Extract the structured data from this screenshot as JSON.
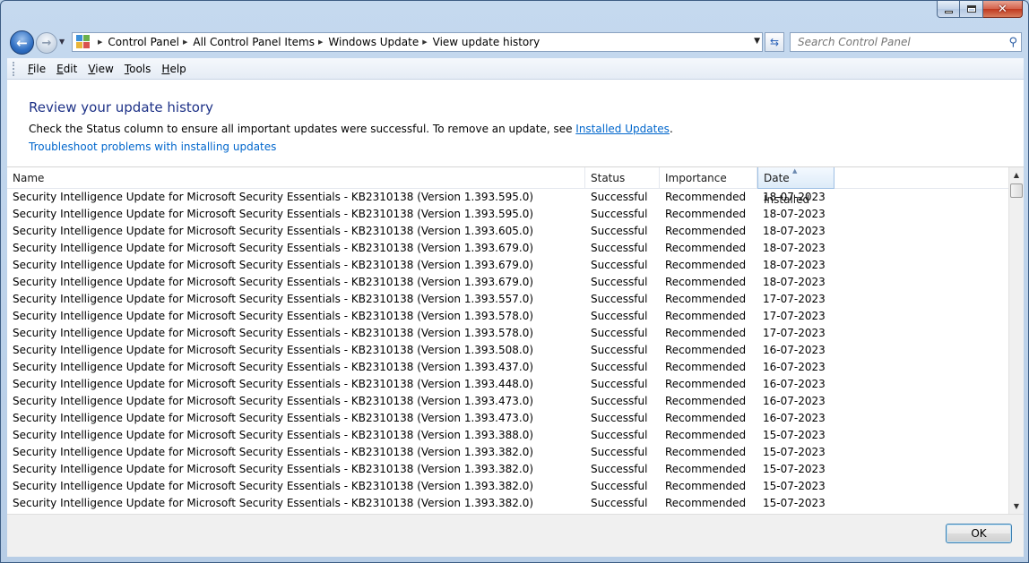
{
  "window": {
    "controls": {
      "minimize": "minimize",
      "maximize": "maximize",
      "close": "close"
    }
  },
  "navigation": {
    "breadcrumbs": [
      "Control Panel",
      "All Control Panel Items",
      "Windows Update",
      "View update history"
    ],
    "search_placeholder": "Search Control Panel"
  },
  "menu": {
    "items": [
      {
        "label": "File",
        "accel": "F",
        "rest": "ile"
      },
      {
        "label": "Edit",
        "accel": "E",
        "rest": "dit"
      },
      {
        "label": "View",
        "accel": "V",
        "rest": "iew"
      },
      {
        "label": "Tools",
        "accel": "T",
        "rest": "ools"
      },
      {
        "label": "Help",
        "accel": "H",
        "rest": "elp"
      }
    ]
  },
  "content": {
    "heading": "Review your update history",
    "description_prefix": "Check the Status column to ensure all important updates were successful. To remove an update, see ",
    "installed_updates_link": "Installed Updates",
    "description_suffix": ".",
    "troubleshoot_link": "Troubleshoot problems with installing updates"
  },
  "table": {
    "columns": [
      "Name",
      "Status",
      "Importance",
      "Date Installed"
    ],
    "sorted_column": "Date Installed",
    "rows": [
      [
        "Security Intelligence Update for Microsoft Security Essentials - KB2310138 (Version 1.393.595.0)",
        "Successful",
        "Recommended",
        "18-07-2023"
      ],
      [
        "Security Intelligence Update for Microsoft Security Essentials - KB2310138 (Version 1.393.595.0)",
        "Successful",
        "Recommended",
        "18-07-2023"
      ],
      [
        "Security Intelligence Update for Microsoft Security Essentials - KB2310138 (Version 1.393.605.0)",
        "Successful",
        "Recommended",
        "18-07-2023"
      ],
      [
        "Security Intelligence Update for Microsoft Security Essentials - KB2310138 (Version 1.393.679.0)",
        "Successful",
        "Recommended",
        "18-07-2023"
      ],
      [
        "Security Intelligence Update for Microsoft Security Essentials - KB2310138 (Version 1.393.679.0)",
        "Successful",
        "Recommended",
        "18-07-2023"
      ],
      [
        "Security Intelligence Update for Microsoft Security Essentials - KB2310138 (Version 1.393.679.0)",
        "Successful",
        "Recommended",
        "18-07-2023"
      ],
      [
        "Security Intelligence Update for Microsoft Security Essentials - KB2310138 (Version 1.393.557.0)",
        "Successful",
        "Recommended",
        "17-07-2023"
      ],
      [
        "Security Intelligence Update for Microsoft Security Essentials - KB2310138 (Version 1.393.578.0)",
        "Successful",
        "Recommended",
        "17-07-2023"
      ],
      [
        "Security Intelligence Update for Microsoft Security Essentials - KB2310138 (Version 1.393.578.0)",
        "Successful",
        "Recommended",
        "17-07-2023"
      ],
      [
        "Security Intelligence Update for Microsoft Security Essentials - KB2310138 (Version 1.393.508.0)",
        "Successful",
        "Recommended",
        "16-07-2023"
      ],
      [
        "Security Intelligence Update for Microsoft Security Essentials - KB2310138 (Version 1.393.437.0)",
        "Successful",
        "Recommended",
        "16-07-2023"
      ],
      [
        "Security Intelligence Update for Microsoft Security Essentials - KB2310138 (Version 1.393.448.0)",
        "Successful",
        "Recommended",
        "16-07-2023"
      ],
      [
        "Security Intelligence Update for Microsoft Security Essentials - KB2310138 (Version 1.393.473.0)",
        "Successful",
        "Recommended",
        "16-07-2023"
      ],
      [
        "Security Intelligence Update for Microsoft Security Essentials - KB2310138 (Version 1.393.473.0)",
        "Successful",
        "Recommended",
        "16-07-2023"
      ],
      [
        "Security Intelligence Update for Microsoft Security Essentials - KB2310138 (Version 1.393.388.0)",
        "Successful",
        "Recommended",
        "15-07-2023"
      ],
      [
        "Security Intelligence Update for Microsoft Security Essentials - KB2310138 (Version 1.393.382.0)",
        "Successful",
        "Recommended",
        "15-07-2023"
      ],
      [
        "Security Intelligence Update for Microsoft Security Essentials - KB2310138 (Version 1.393.382.0)",
        "Successful",
        "Recommended",
        "15-07-2023"
      ],
      [
        "Security Intelligence Update for Microsoft Security Essentials - KB2310138 (Version 1.393.382.0)",
        "Successful",
        "Recommended",
        "15-07-2023"
      ],
      [
        "Security Intelligence Update for Microsoft Security Essentials - KB2310138 (Version 1.393.382.0)",
        "Successful",
        "Recommended",
        "15-07-2023"
      ]
    ]
  },
  "footer": {
    "ok_label": "OK"
  },
  "colors": {
    "heading": "#1e3287",
    "link": "#0066cc",
    "frame": "#b7cde6"
  }
}
